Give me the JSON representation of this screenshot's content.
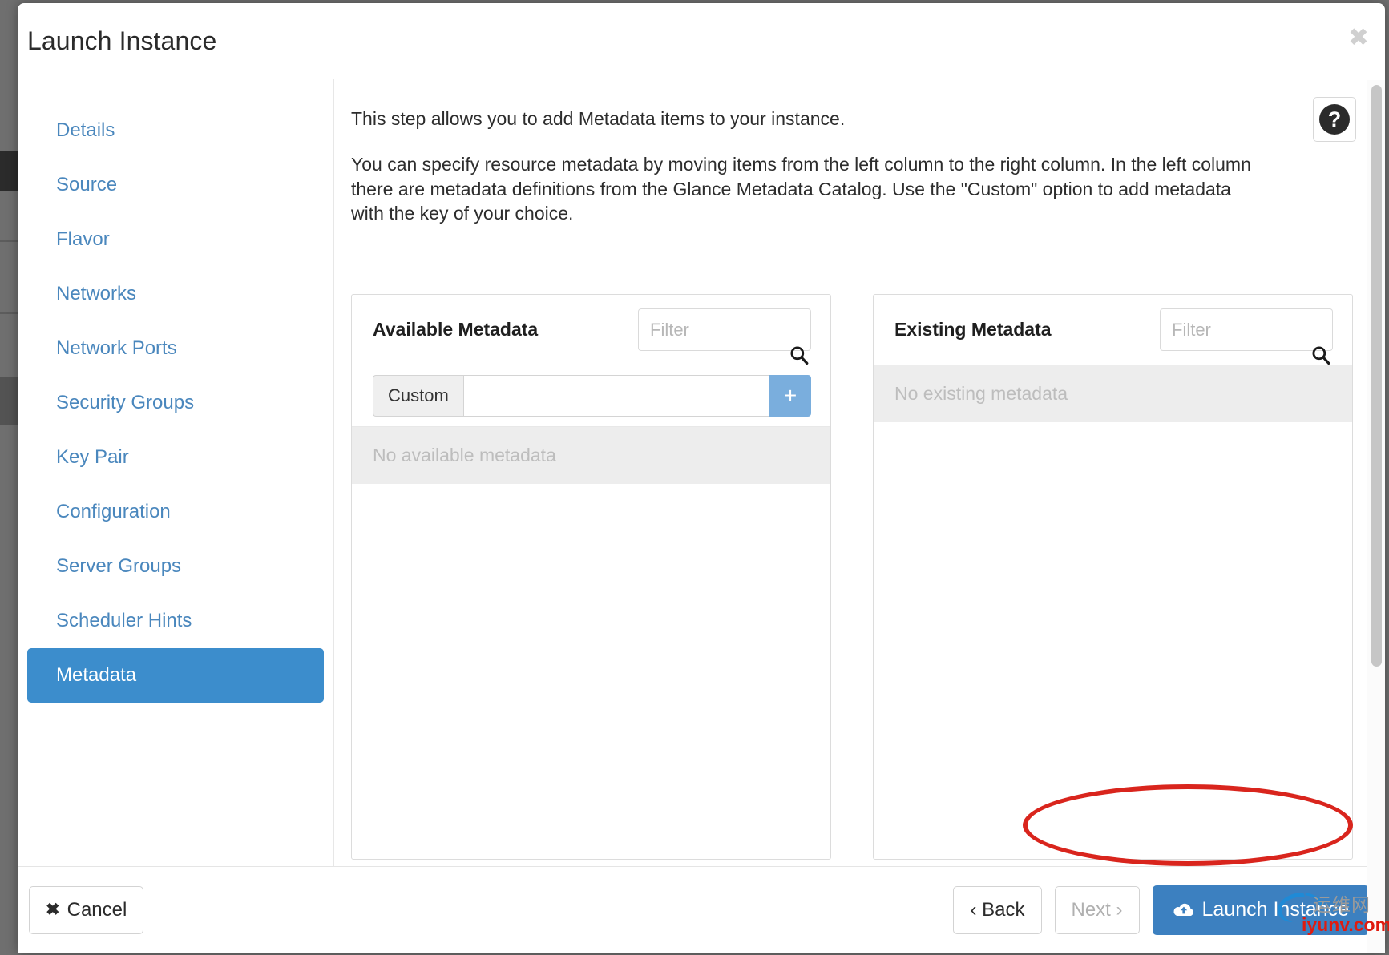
{
  "window": {
    "title": "Launch Instance",
    "close_label": "✖"
  },
  "sidebar": {
    "items": [
      {
        "label": "Details",
        "active": false
      },
      {
        "label": "Source",
        "active": false
      },
      {
        "label": "Flavor",
        "active": false
      },
      {
        "label": "Networks",
        "active": false
      },
      {
        "label": "Network Ports",
        "active": false
      },
      {
        "label": "Security Groups",
        "active": false
      },
      {
        "label": "Key Pair",
        "active": false
      },
      {
        "label": "Configuration",
        "active": false
      },
      {
        "label": "Server Groups",
        "active": false
      },
      {
        "label": "Scheduler Hints",
        "active": false
      },
      {
        "label": "Metadata",
        "active": true
      }
    ]
  },
  "content": {
    "intro_1": "This step allows you to add Metadata items to your instance.",
    "intro_2": "You can specify resource metadata by moving items from the left column to the right column. In the left column there are metadata definitions from the Glance Metadata Catalog. Use the \"Custom\" option to add metadata with the key of your choice.",
    "help_glyph": "?"
  },
  "available_panel": {
    "title": "Available Metadata",
    "filter_placeholder": "Filter",
    "filter_value": "",
    "custom_label": "Custom",
    "custom_placeholder": "",
    "custom_value": "",
    "add_label": "+",
    "empty_text": "No available metadata"
  },
  "existing_panel": {
    "title": "Existing Metadata",
    "filter_placeholder": "Filter",
    "filter_value": "",
    "empty_text": "No existing metadata"
  },
  "footer": {
    "cancel_label": "Cancel",
    "cancel_glyph": "✖",
    "back_label": "‹ Back",
    "next_label": "Next ›",
    "launch_label": "Launch Instance"
  },
  "watermark": {
    "cn_text": "运维网",
    "url_text": "iyunv.com"
  },
  "colors": {
    "accent_blue": "#3c8dcc",
    "primary_button": "#3c80c0",
    "link_blue": "#4a87bd",
    "add_button": "#7aaedd",
    "annotation_red": "#d9251d",
    "muted_text": "#bdbdbd"
  }
}
